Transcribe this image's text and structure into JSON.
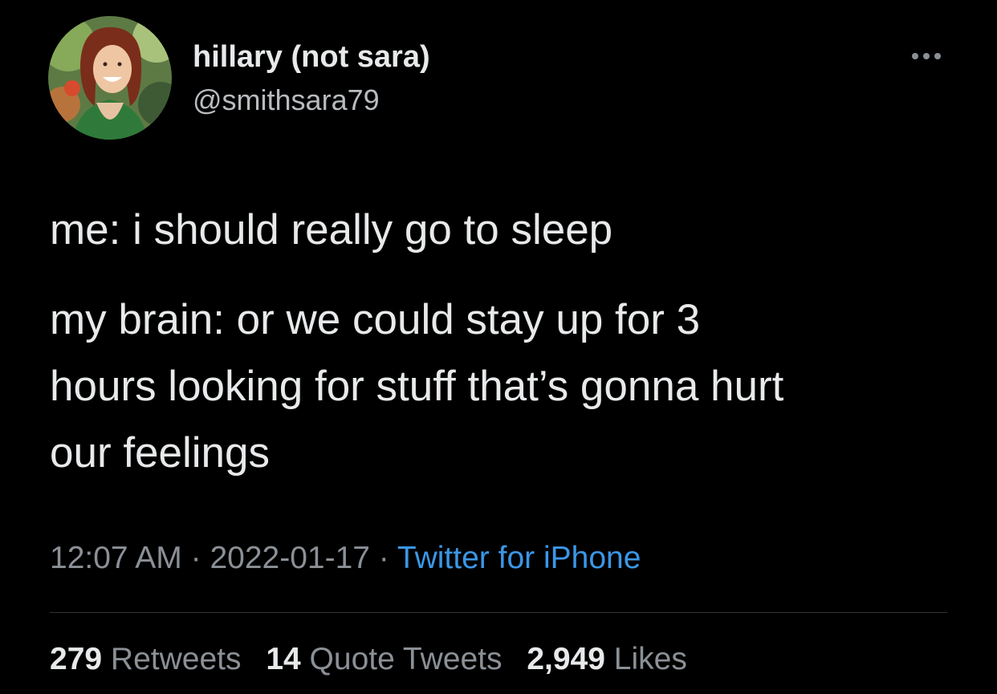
{
  "colors": {
    "background": "#000000",
    "primary_text": "#e7e9ea",
    "secondary_text": "#8b9096",
    "link": "#3b97e6",
    "divider": "#2f3336"
  },
  "author": {
    "display_name": "hillary (not sara)",
    "handle": "@smithsara79",
    "avatar_icon": "profile-photo"
  },
  "menu": {
    "icon": "more-horizontal-icon",
    "glyph": "···"
  },
  "tweet": {
    "paragraphs": [
      "me: i should really go to sleep",
      "my brain: or we could stay up for 3\nhours looking for stuff that’s gonna hurt\nour feelings"
    ]
  },
  "meta": {
    "time": "12:07 AM",
    "separator": " · ",
    "date": "2022-01-17",
    "source": "Twitter for iPhone"
  },
  "stats": {
    "retweets": {
      "count": "279",
      "label": " Retweets"
    },
    "quote_tweets": {
      "count": "14",
      "label": " Quote Tweets"
    },
    "likes": {
      "count": "2,949",
      "label": " Likes"
    }
  }
}
